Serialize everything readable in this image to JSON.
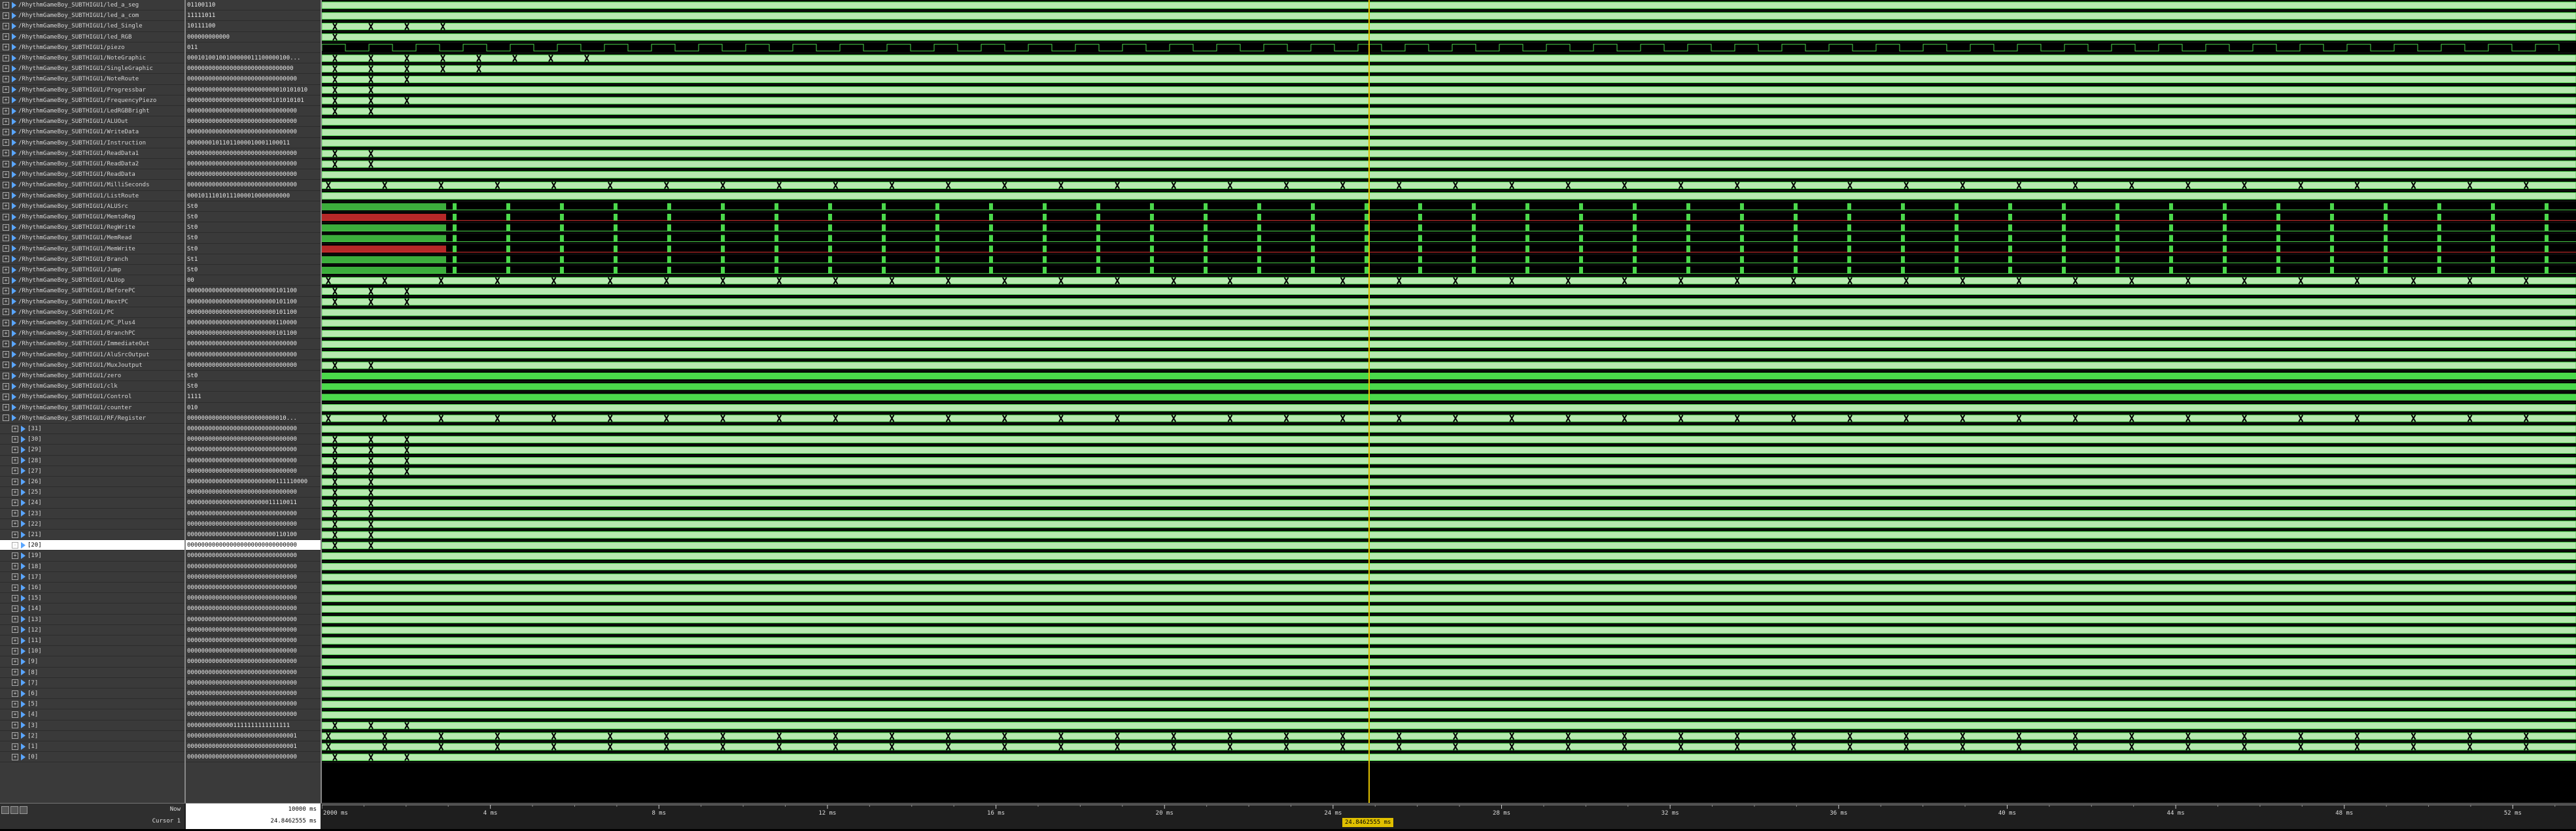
{
  "colors": {
    "panel_bg": "#3a3a3a",
    "wave_bg": "#000000",
    "wave_green": "#4bd84b",
    "bus_fill": "#b7e9b0",
    "wave_red": "#e33232",
    "cursor": "#e0c000",
    "selected_row": "#ffffff"
  },
  "signals": [
    {
      "name": "/RhythmGameBoy_SUBTHIGU1/led_a_seg",
      "value": "01100110",
      "kind": "bus",
      "edges": 0
    },
    {
      "name": "/RhythmGameBoy_SUBTHIGU1/led_a_com",
      "value": "11111011",
      "kind": "bus",
      "edges": 0
    },
    {
      "name": "/RhythmGameBoy_SUBTHIGU1/led_Single",
      "value": "10111100",
      "kind": "bus",
      "edges": 4
    },
    {
      "name": "/RhythmGameBoy_SUBTHIGU1/led_RGB",
      "value": "000000000000",
      "kind": "bus",
      "edges": 1
    },
    {
      "name": "/RhythmGameBoy_SUBTHIGU1/piezo",
      "value": "011",
      "kind": "bit",
      "edges": 0
    },
    {
      "name": "/RhythmGameBoy_SUBTHIGU1/NoteGraphic",
      "value": "00010100100100000011100000100...",
      "kind": "bus",
      "edges": 8
    },
    {
      "name": "/RhythmGameBoy_SUBTHIGU1/SingleGraphic",
      "value": "000000000000000000000000000000",
      "kind": "bus",
      "edges": 5
    },
    {
      "name": "/RhythmGameBoy_SUBTHIGU1/NoteRoute",
      "value": "0000000000000000000000000000000",
      "kind": "bus",
      "edges": 3
    },
    {
      "name": "/RhythmGameBoy_SUBTHIGU1/Progressbar",
      "value": "0000000000000000000000000010101010",
      "kind": "bus",
      "edges": 2
    },
    {
      "name": "/RhythmGameBoy_SUBTHIGU1/FrequencyPiezo",
      "value": "000000000000000000000000101010101",
      "kind": "bus",
      "edges": 3
    },
    {
      "name": "/RhythmGameBoy_SUBTHIGU1/LedRGBBright",
      "value": "0000000000000000000000000000000",
      "kind": "bus",
      "edges": 2
    },
    {
      "name": "/RhythmGameBoy_SUBTHIGU1/ALUOut",
      "value": "0000000000000000000000000000000",
      "kind": "bus",
      "edges": 0
    },
    {
      "name": "/RhythmGameBoy_SUBTHIGU1/WriteData",
      "value": "0000000000000000000000000000000",
      "kind": "bus",
      "edges": 0
    },
    {
      "name": "/RhythmGameBoy_SUBTHIGU1/Instruction",
      "value": "00000001011011000010001100011",
      "kind": "bus",
      "edges": 0
    },
    {
      "name": "/RhythmGameBoy_SUBTHIGU1/ReadData1",
      "value": "0000000000000000000000000000000",
      "kind": "bus",
      "edges": 2
    },
    {
      "name": "/RhythmGameBoy_SUBTHIGU1/ReadData2",
      "value": "0000000000000000000000000000000",
      "kind": "bus",
      "edges": 2
    },
    {
      "name": "/RhythmGameBoy_SUBTHIGU1/ReadData",
      "value": "0000000000000000000000000000000",
      "kind": "bus",
      "edges": 0
    },
    {
      "name": "/RhythmGameBoy_SUBTHIGU1/MilliSeconds",
      "value": "0000000000000000000000000000000",
      "kind": "bus",
      "edges": 40
    },
    {
      "name": "/RhythmGameBoy_SUBTHIGU1/ListRoute",
      "value": "00010111010111000010000000000",
      "kind": "bus",
      "edges": 0
    },
    {
      "name": "/RhythmGameBoy_SUBTHIGU1/ALUSrc",
      "value": "St0",
      "kind": "pulse",
      "edges": 40
    },
    {
      "name": "/RhythmGameBoy_SUBTHIGU1/MemtoReg",
      "value": "St0",
      "kind": "pulse_red",
      "edges": 40
    },
    {
      "name": "/RhythmGameBoy_SUBTHIGU1/RegWrite",
      "value": "St0",
      "kind": "pulse",
      "edges": 40
    },
    {
      "name": "/RhythmGameBoy_SUBTHIGU1/MemRead",
      "value": "St0",
      "kind": "pulse",
      "edges": 40
    },
    {
      "name": "/RhythmGameBoy_SUBTHIGU1/MemWrite",
      "value": "St0",
      "kind": "pulse_red",
      "edges": 40
    },
    {
      "name": "/RhythmGameBoy_SUBTHIGU1/Branch",
      "value": "St1",
      "kind": "pulse",
      "edges": 40
    },
    {
      "name": "/RhythmGameBoy_SUBTHIGU1/Jump",
      "value": "St0",
      "kind": "pulse",
      "edges": 40
    },
    {
      "name": "/RhythmGameBoy_SUBTHIGU1/ALUop",
      "value": "00",
      "kind": "bus",
      "edges": 40
    },
    {
      "name": "/RhythmGameBoy_SUBTHIGU1/BeforePC",
      "value": "0000000000000000000000000101100",
      "kind": "bus",
      "edges": 3
    },
    {
      "name": "/RhythmGameBoy_SUBTHIGU1/NextPC",
      "value": "0000000000000000000000000101100",
      "kind": "bus",
      "edges": 3
    },
    {
      "name": "/RhythmGameBoy_SUBTHIGU1/PC",
      "value": "0000000000000000000000000101100",
      "kind": "bus",
      "edges": 0
    },
    {
      "name": "/RhythmGameBoy_SUBTHIGU1/PC_Plus4",
      "value": "0000000000000000000000000110000",
      "kind": "bus",
      "edges": 0
    },
    {
      "name": "/RhythmGameBoy_SUBTHIGU1/BranchPC",
      "value": "0000000000000000000000000101100",
      "kind": "bus",
      "edges": 0
    },
    {
      "name": "/RhythmGameBoy_SUBTHIGU1/ImmediateOut",
      "value": "0000000000000000000000000000000",
      "kind": "bus",
      "edges": 0
    },
    {
      "name": "/RhythmGameBoy_SUBTHIGU1/AluSrcOutput",
      "value": "0000000000000000000000000000000",
      "kind": "bus",
      "edges": 0
    },
    {
      "name": "/RhythmGameBoy_SUBTHIGU1/MuxJoutput",
      "value": "0000000000000000000000000000000",
      "kind": "bus",
      "edges": 2
    },
    {
      "name": "/RhythmGameBoy_SUBTHIGU1/zero",
      "value": "St0",
      "kind": "solid",
      "edges": 0
    },
    {
      "name": "/RhythmGameBoy_SUBTHIGU1/clk",
      "value": "St0",
      "kind": "solid",
      "edges": 0
    },
    {
      "name": "/RhythmGameBoy_SUBTHIGU1/Control",
      "value": "1111",
      "kind": "solid",
      "edges": 0
    },
    {
      "name": "/RhythmGameBoy_SUBTHIGU1/counter",
      "value": "010",
      "kind": "bus",
      "edges": 0
    },
    {
      "name": "/RhythmGameBoy_SUBTHIGU1/RF/Register",
      "value": "0000000000000000000000000010...",
      "kind": "bus",
      "edges": 40,
      "expanded": true
    },
    {
      "name": "[31]",
      "value": "0000000000000000000000000000000",
      "kind": "bus",
      "edges": 0,
      "child": true
    },
    {
      "name": "[30]",
      "value": "0000000000000000000000000000000",
      "kind": "bus",
      "edges": 3,
      "child": true
    },
    {
      "name": "[29]",
      "value": "0000000000000000000000000000000",
      "kind": "bus",
      "edges": 3,
      "child": true
    },
    {
      "name": "[28]",
      "value": "0000000000000000000000000000000",
      "kind": "bus",
      "edges": 3,
      "child": true
    },
    {
      "name": "[27]",
      "value": "0000000000000000000000000000000",
      "kind": "bus",
      "edges": 3,
      "child": true
    },
    {
      "name": "[26]",
      "value": "0000000000000000000000000111110000",
      "kind": "bus",
      "edges": 2,
      "child": true
    },
    {
      "name": "[25]",
      "value": "0000000000000000000000000000000",
      "kind": "bus",
      "edges": 2,
      "child": true
    },
    {
      "name": "[24]",
      "value": "0000000000000000000000011110011",
      "kind": "bus",
      "edges": 2,
      "child": true
    },
    {
      "name": "[23]",
      "value": "0000000000000000000000000000000",
      "kind": "bus",
      "edges": 2,
      "child": true
    },
    {
      "name": "[22]",
      "value": "0000000000000000000000000000000",
      "kind": "bus",
      "edges": 2,
      "child": true
    },
    {
      "name": "[21]",
      "value": "0000000000000000000000000110100",
      "kind": "bus",
      "edges": 2,
      "child": true
    },
    {
      "name": "[20]",
      "value": "0000000000000000000000000000000",
      "kind": "bus",
      "edges": 2,
      "child": true,
      "selected": true
    },
    {
      "name": "[19]",
      "value": "0000000000000000000000000000000",
      "kind": "bus",
      "edges": 0,
      "child": true
    },
    {
      "name": "[18]",
      "value": "0000000000000000000000000000000",
      "kind": "bus",
      "edges": 0,
      "child": true
    },
    {
      "name": "[17]",
      "value": "0000000000000000000000000000000",
      "kind": "bus",
      "edges": 0,
      "child": true
    },
    {
      "name": "[16]",
      "value": "0000000000000000000000000000000",
      "kind": "bus",
      "edges": 0,
      "child": true
    },
    {
      "name": "[15]",
      "value": "0000000000000000000000000000000",
      "kind": "bus",
      "edges": 0,
      "child": true
    },
    {
      "name": "[14]",
      "value": "0000000000000000000000000000000",
      "kind": "bus",
      "edges": 0,
      "child": true
    },
    {
      "name": "[13]",
      "value": "0000000000000000000000000000000",
      "kind": "bus",
      "edges": 0,
      "child": true
    },
    {
      "name": "[12]",
      "value": "0000000000000000000000000000000",
      "kind": "bus",
      "edges": 0,
      "child": true
    },
    {
      "name": "[11]",
      "value": "0000000000000000000000000000000",
      "kind": "bus",
      "edges": 0,
      "child": true
    },
    {
      "name": "[10]",
      "value": "0000000000000000000000000000000",
      "kind": "bus",
      "edges": 0,
      "child": true
    },
    {
      "name": "[9]",
      "value": "0000000000000000000000000000000",
      "kind": "bus",
      "edges": 0,
      "child": true
    },
    {
      "name": "[8]",
      "value": "0000000000000000000000000000000",
      "kind": "bus",
      "edges": 0,
      "child": true
    },
    {
      "name": "[7]",
      "value": "0000000000000000000000000000000",
      "kind": "bus",
      "edges": 0,
      "child": true
    },
    {
      "name": "[6]",
      "value": "0000000000000000000000000000000",
      "kind": "bus",
      "edges": 0,
      "child": true
    },
    {
      "name": "[5]",
      "value": "0000000000000000000000000000000",
      "kind": "bus",
      "edges": 0,
      "child": true
    },
    {
      "name": "[4]",
      "value": "0000000000000000000000000000000",
      "kind": "bus",
      "edges": 0,
      "child": true
    },
    {
      "name": "[3]",
      "value": "00000000000001111111111111111",
      "kind": "bus",
      "edges": 3,
      "child": true
    },
    {
      "name": "[2]",
      "value": "0000000000000000000000000000001",
      "kind": "bus",
      "edges": 40,
      "child": true
    },
    {
      "name": "[1]",
      "value": "0000000000000000000000000000001",
      "kind": "bus",
      "edges": 40,
      "child": true
    },
    {
      "name": "[0]",
      "value": "0000000000000000000000000000000",
      "kind": "bus",
      "edges": 3,
      "child": true
    }
  ],
  "timeline": {
    "ticks": [
      "2000 ms",
      "4 ms",
      "8 ms",
      "12 ms",
      "16 ms",
      "20 ms",
      "24 ms",
      "28 ms",
      "32 ms",
      "36 ms",
      "40 ms",
      "44 ms",
      "48 ms",
      "52 ms"
    ],
    "range_ms": [
      0,
      53.5
    ],
    "cursor_ms": 24.84
  },
  "status": {
    "now_label": "Now",
    "now_value": "10000 ms",
    "cursor_label": "Cursor 1",
    "cursor_value": "24.8462555 ms",
    "cursor_tag": "24.8462555 ms"
  }
}
